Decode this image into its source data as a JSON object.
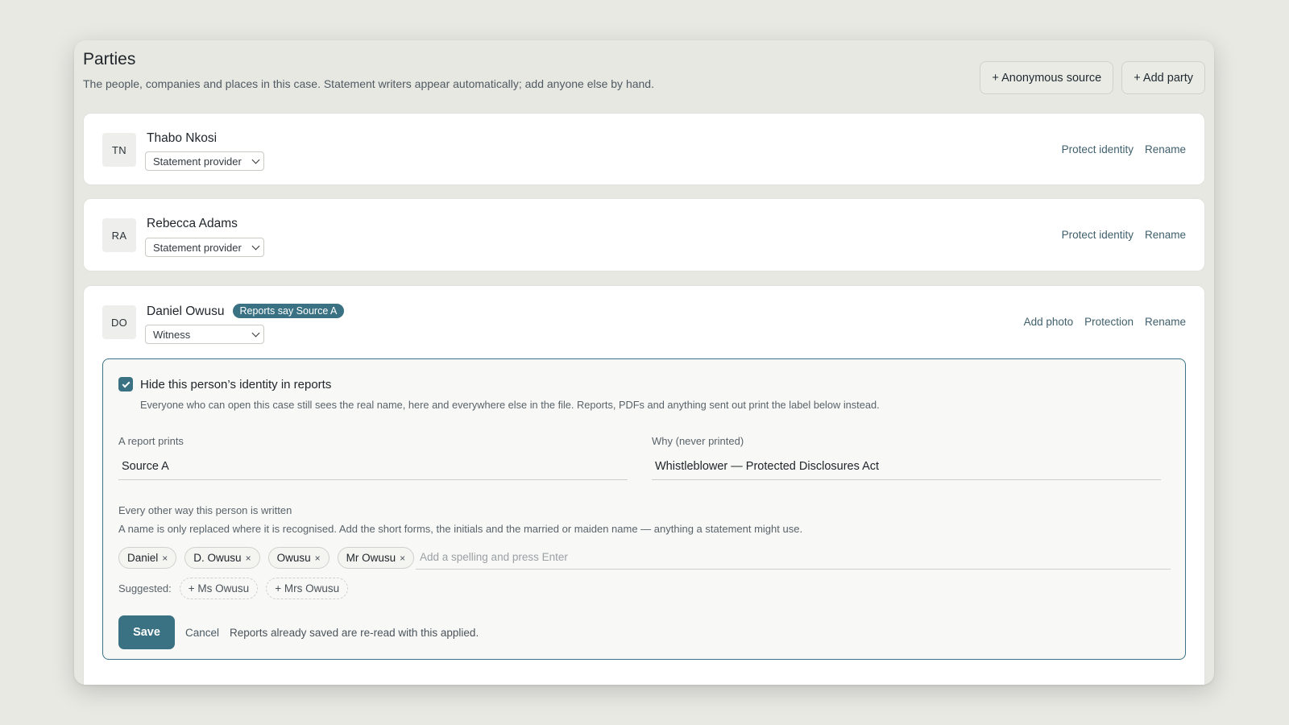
{
  "header": {
    "title": "Parties",
    "subtitle": "The people, companies and places in this case. Statement writers appear automatically; add anyone else by hand.",
    "anonymous_source_label": "+ Anonymous source",
    "add_party_label": "+ Add party"
  },
  "parties": [
    {
      "initials": "TN",
      "name": "Thabo Nkosi",
      "role": "Statement provider",
      "actions": [
        "Protect identity",
        "Rename"
      ]
    },
    {
      "initials": "RA",
      "name": "Rebecca Adams",
      "role": "Statement provider",
      "actions": [
        "Protect identity",
        "Rename"
      ]
    },
    {
      "initials": "DO",
      "name": "Daniel Owusu",
      "badge": "Reports say Source A",
      "role": "Witness",
      "actions": [
        "Add photo",
        "Protection",
        "Rename"
      ]
    }
  ],
  "protection": {
    "checked": true,
    "checkbox_label": "Hide this person’s identity in reports",
    "checkbox_help": "Everyone who can open this case still sees the real name, here and everywhere else in the file. Reports, PDFs and anything sent out print the label below instead.",
    "report_label": "A report prints",
    "report_value": "Source A",
    "why_label": "Why (never printed)",
    "why_value": "Whistleblower — Protected Disclosures Act",
    "aliases_title": "Every other way this person is written",
    "aliases_help": "A name is only replaced where it is recognised. Add the short forms, the initials and the married or maiden name — anything a statement might use.",
    "aliases": [
      "Daniel",
      "D. Owusu",
      "Owusu",
      "Mr Owusu"
    ],
    "alias_placeholder": "Add a spelling and press Enter",
    "suggested_label": "Suggested:",
    "suggestions": [
      "+ Ms Owusu",
      "+ Mrs Owusu"
    ],
    "save_label": "Save",
    "cancel_label": "Cancel",
    "save_note": "Reports already saved are re-read with this applied."
  },
  "colors": {
    "accent": "#3a7283",
    "background": "#e9e9e4"
  }
}
